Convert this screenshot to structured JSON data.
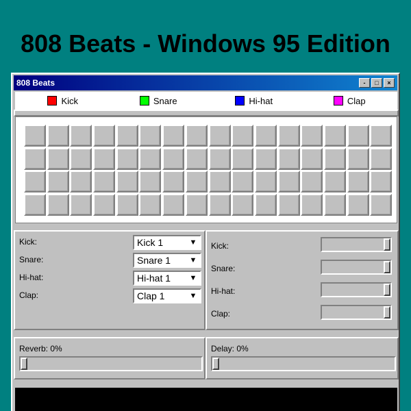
{
  "page": {
    "title": "808 Beats - Windows 95 Edition"
  },
  "window": {
    "title": "808 Beats",
    "buttons": {
      "minimize": "-",
      "maximize": "□",
      "close": "×"
    }
  },
  "legend": [
    {
      "label": "Kick",
      "color": "#ff0000"
    },
    {
      "label": "Snare",
      "color": "#00ff00"
    },
    {
      "label": "Hi-hat",
      "color": "#0000ff"
    },
    {
      "label": "Clap",
      "color": "#ff00ff"
    }
  ],
  "sequencer": {
    "rows": 4,
    "steps": 16
  },
  "sound_selectors": [
    {
      "label": "Kick:",
      "value": "Kick 1"
    },
    {
      "label": "Snare:",
      "value": "Snare 1"
    },
    {
      "label": "Hi-hat:",
      "value": "Hi-hat 1"
    },
    {
      "label": "Clap:",
      "value": "Clap 1"
    }
  ],
  "volume_sliders": [
    {
      "label": "Kick:",
      "value": 1.0
    },
    {
      "label": "Snare:",
      "value": 1.0
    },
    {
      "label": "Hi-hat:",
      "value": 1.0
    },
    {
      "label": "Clap:",
      "value": 1.0
    }
  ],
  "effects": {
    "reverb": {
      "label": "Reverb: 0%",
      "value": 0
    },
    "delay": {
      "label": "Delay: 0%",
      "value": 0
    }
  }
}
